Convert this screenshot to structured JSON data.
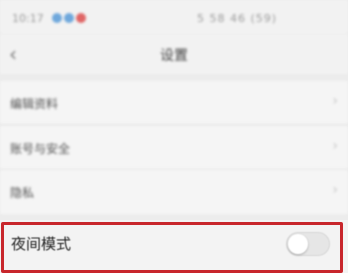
{
  "status_bar": {
    "time": "10:17",
    "right_text": "5 58 46 (59)",
    "dots": [
      "#6fa8dc",
      "#6fa8dc",
      "#e06666"
    ]
  },
  "header": {
    "back_icon": "chevron-left-icon",
    "title": "设置"
  },
  "menu": {
    "items": [
      {
        "label": "编辑资料"
      },
      {
        "label": "账号与安全"
      },
      {
        "label": "隐私"
      }
    ],
    "chevron_icon": "chevron-right-icon"
  },
  "night_mode": {
    "label": "夜间模式",
    "enabled": false,
    "highlight_color": "#c8262c"
  }
}
